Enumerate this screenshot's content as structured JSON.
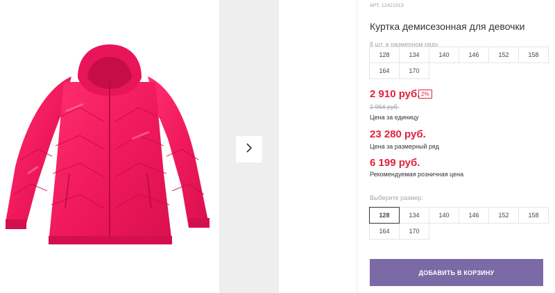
{
  "product": {
    "article": "АРТ. 12421013",
    "title": "Куртка демисезонная для девочки",
    "row_note": "8 шт. в размерном ряду",
    "row_sizes": [
      "128",
      "134",
      "140",
      "146",
      "152",
      "158",
      "164",
      "170"
    ],
    "price": "2 910 руб.",
    "discount": "2%",
    "old_price": "2 964 руб.",
    "unit_label": "Цена за единицу",
    "row_price": "23 280 руб.",
    "row_price_label": "Цена за размерный ряд",
    "retail_price": "6 199 руб.",
    "retail_label": "Рекомендуемая розничная цена",
    "choose_label": "Выберите размер:",
    "choose_sizes": [
      "128",
      "134",
      "140",
      "146",
      "152",
      "158",
      "164",
      "170"
    ],
    "selected_size": "128",
    "cart_button": "ДОБАВИТЬ В КОРЗИНУ"
  },
  "colors": {
    "price": "#e0223b",
    "button": "#7b6aa6",
    "jacket": "#f0195d"
  },
  "icons": {
    "next": "chevron-right-icon"
  }
}
